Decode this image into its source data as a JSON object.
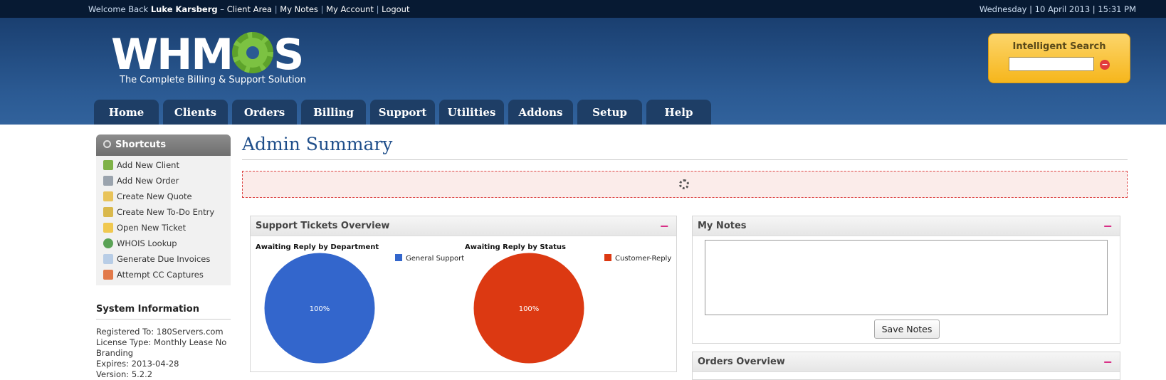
{
  "topbar": {
    "welcome_prefix": "Welcome Back",
    "user": "Luke Karsberg",
    "dash": "–",
    "links": [
      "Client Area",
      "My Notes",
      "My Account",
      "Logout"
    ],
    "separator": "|",
    "datetime": "Wednesday | 10 April 2013 | 15:31 PM"
  },
  "brand": {
    "name": "WHMCS",
    "tagline": "The Complete Billing & Support Solution"
  },
  "search": {
    "label": "Intelligent Search",
    "value": "",
    "clear_icon": "minus-circle-icon"
  },
  "nav": [
    "Home",
    "Clients",
    "Orders",
    "Billing",
    "Support",
    "Utilities",
    "Addons",
    "Setup",
    "Help"
  ],
  "sidebar": {
    "shortcuts_title": "Shortcuts",
    "shortcuts": [
      {
        "label": "Add New Client",
        "icon": "add-user-icon"
      },
      {
        "label": "Add New Order",
        "icon": "cart-icon"
      },
      {
        "label": "Create New Quote",
        "icon": "quote-icon"
      },
      {
        "label": "Create New To-Do Entry",
        "icon": "todo-icon"
      },
      {
        "label": "Open New Ticket",
        "icon": "ticket-icon"
      },
      {
        "label": "WHOIS Lookup",
        "icon": "globe-icon"
      },
      {
        "label": "Generate Due Invoices",
        "icon": "invoice-icon"
      },
      {
        "label": "Attempt CC Captures",
        "icon": "credit-card-icon"
      }
    ],
    "system_title": "System Information",
    "system_lines": [
      "Registered To: 180Servers.com",
      "License Type: Monthly Lease No",
      "Branding",
      "Expires: 2013-04-28",
      "Version: 5.2.2"
    ]
  },
  "main": {
    "title": "Admin Summary",
    "tickets_panel": {
      "title": "Support Tickets Overview",
      "toggle": "−",
      "charts": [
        {
          "title": "Awaiting Reply by Department",
          "legend": "General Support",
          "label": "100%",
          "color": "#3366cc"
        },
        {
          "title": "Awaiting Reply by Status",
          "legend": "Customer-Reply",
          "label": "100%",
          "color": "#dc3912"
        }
      ]
    },
    "notes_panel": {
      "title": "My Notes",
      "toggle": "−",
      "text": "",
      "save_label": "Save Notes"
    },
    "orders_panel": {
      "title": "Orders Overview",
      "toggle": "−"
    }
  },
  "chart_data": [
    {
      "type": "pie",
      "title": "Awaiting Reply by Department",
      "categories": [
        "General Support"
      ],
      "values": [
        100
      ],
      "legend_position": "right"
    },
    {
      "type": "pie",
      "title": "Awaiting Reply by Status",
      "categories": [
        "Customer-Reply"
      ],
      "values": [
        100
      ],
      "legend_position": "right"
    }
  ]
}
